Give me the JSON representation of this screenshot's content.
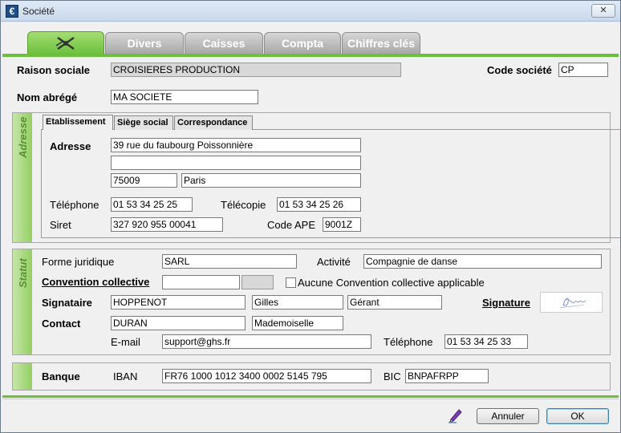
{
  "window": {
    "title": "Société",
    "close_label": "✕"
  },
  "tabs": [
    {
      "label": "",
      "icon": "scissors-logo-icon"
    },
    {
      "label": "Divers"
    },
    {
      "label": "Caisses"
    },
    {
      "label": "Compta"
    },
    {
      "label": "Chiffres clés"
    }
  ],
  "header": {
    "raison_sociale_label": "Raison sociale",
    "raison_sociale_value": "CROISIERES PRODUCTION",
    "code_societe_label": "Code société",
    "code_societe_value": "CP",
    "nom_abrege_label": "Nom abrégé",
    "nom_abrege_value": "MA SOCIETE"
  },
  "adresse": {
    "section_label": "Adresse",
    "subtabs": [
      "Etablissement",
      "Siège social",
      "Correspondance"
    ],
    "adresse_label": "Adresse",
    "line1": "39 rue du faubourg Poissonnière",
    "line2": "",
    "postal_code": "75009",
    "city": "Paris",
    "telephone_label": "Téléphone",
    "telephone_value": "01 53 34 25 25",
    "telecopie_label": "Télécopie",
    "telecopie_value": "01 53 34 25 26",
    "siret_label": "Siret",
    "siret_value": "327 920 955 00041",
    "code_ape_label": "Code APE",
    "code_ape_value": "9001Z"
  },
  "statut": {
    "section_label": "Statut",
    "forme_juridique_label": "Forme juridique",
    "forme_juridique_value": "SARL",
    "activite_label": "Activité",
    "activite_value": "Compagnie de danse",
    "convention_label": "Convention collective",
    "convention_value": "",
    "convention_code": "",
    "aucune_label": "Aucune Convention collective applicable",
    "signataire_label": "Signataire",
    "signataire_nom": "HOPPENOT",
    "signataire_prenom": "Gilles",
    "signataire_fonction": "Gérant",
    "signature_label": "Signature",
    "contact_label": "Contact",
    "contact_nom": "DURAN",
    "contact_civilite": "Mademoiselle",
    "email_label": "E-mail",
    "email_value": "support@ghs.fr",
    "telephone_label": "Téléphone",
    "telephone_value": "01 53 34 25 33"
  },
  "banque": {
    "banque_label": "Banque",
    "iban_label": "IBAN",
    "iban_value": "FR76 1000 1012 3400 0002 5145 795",
    "bic_label": "BIC",
    "bic_value": "BNPAFRPP"
  },
  "footer": {
    "annuler_label": "Annuler",
    "ok_label": "OK"
  },
  "colors": {
    "accent_green": "#6cbf3c",
    "tab_gray": "#a8a8a8"
  }
}
